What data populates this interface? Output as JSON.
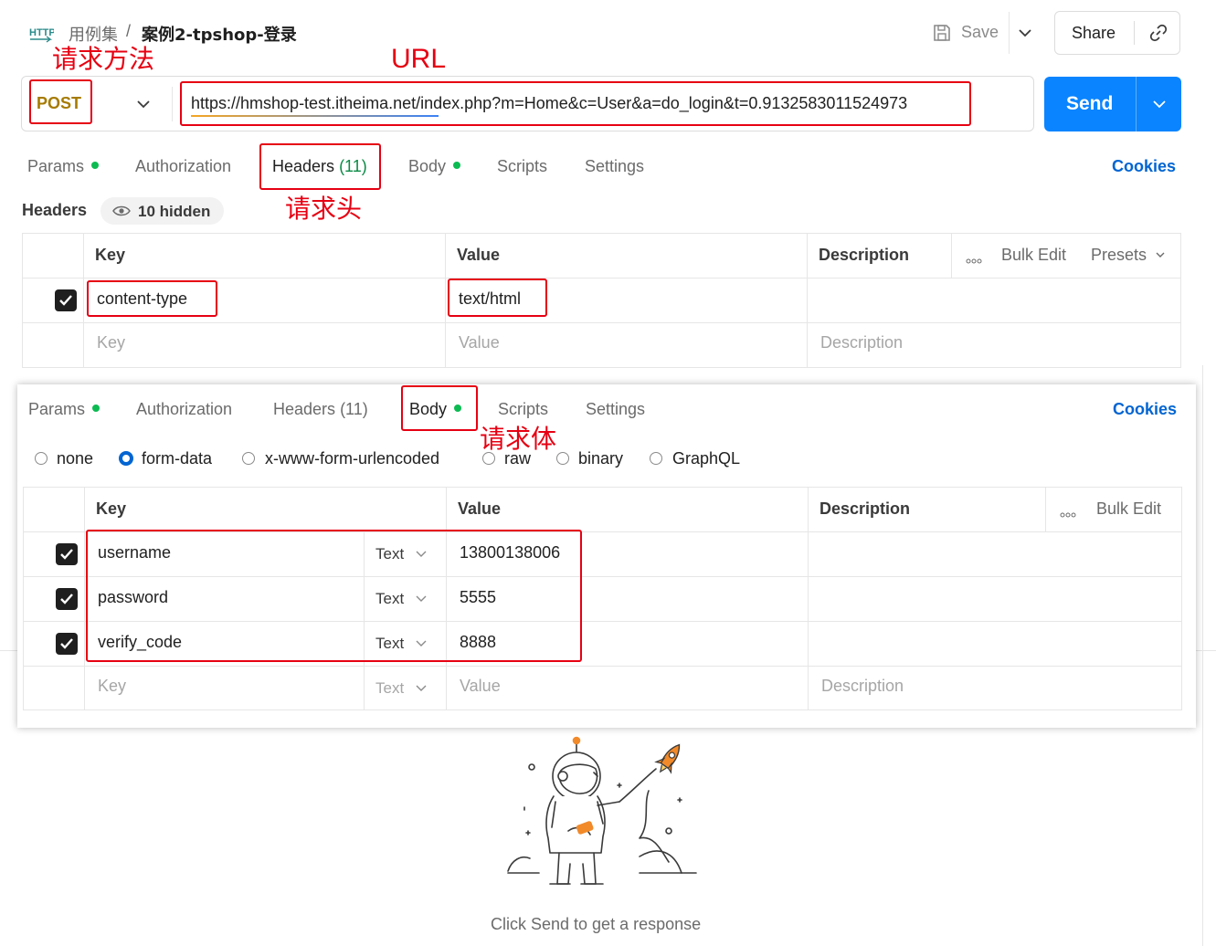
{
  "header": {
    "http_badge": "HTTP",
    "collection": "用例集",
    "separator": "/",
    "request_name": "案例2-tpshop-登录",
    "save_label": "Save",
    "share_label": "Share"
  },
  "request": {
    "method": "POST",
    "url": "https://hmshop-test.itheima.net/index.php?m=Home&c=User&a=do_login&t=0.9132583011524973",
    "send_label": "Send"
  },
  "annotations": {
    "method": "请求方法",
    "url": "URL",
    "headers": "请求头",
    "body": "请求体"
  },
  "tabs": [
    {
      "label": "Params",
      "dot": true
    },
    {
      "label": "Authorization",
      "dot": false
    },
    {
      "label": "Headers",
      "count": "(11)",
      "dot": false
    },
    {
      "label": "Body",
      "dot": true
    },
    {
      "label": "Scripts",
      "dot": false
    },
    {
      "label": "Settings",
      "dot": false
    }
  ],
  "cookies_label": "Cookies",
  "headers_section": {
    "title": "Headers",
    "hidden_label": "10 hidden",
    "columns": {
      "key": "Key",
      "value": "Value",
      "description": "Description"
    },
    "bulk_edit": "Bulk Edit",
    "presets": "Presets",
    "rows": [
      {
        "key": "content-type",
        "value": "text/html",
        "checked": true
      }
    ],
    "placeholder": {
      "key": "Key",
      "value": "Value",
      "description": "Description"
    }
  },
  "body_section": {
    "modes": [
      "none",
      "form-data",
      "x-www-form-urlencoded",
      "raw",
      "binary",
      "GraphQL"
    ],
    "selected_mode": "form-data",
    "columns": {
      "key": "Key",
      "value": "Value",
      "description": "Description"
    },
    "bulk_edit": "Bulk Edit",
    "rows": [
      {
        "key": "username",
        "type": "Text",
        "value": "13800138006",
        "checked": true
      },
      {
        "key": "password",
        "type": "Text",
        "value": "5555",
        "checked": true
      },
      {
        "key": "verify_code",
        "type": "Text",
        "value": "8888",
        "checked": true
      }
    ],
    "placeholder": {
      "key": "Key",
      "type": "Text",
      "value": "Value",
      "description": "Description"
    }
  },
  "response": {
    "hint": "Click Send to get a response"
  },
  "colors": {
    "accent": "#0265d2",
    "send_button": "#0a84ff",
    "method_post": "#a67b00",
    "annotation_red": "#e60012",
    "active_dot": "#0cbb52"
  }
}
